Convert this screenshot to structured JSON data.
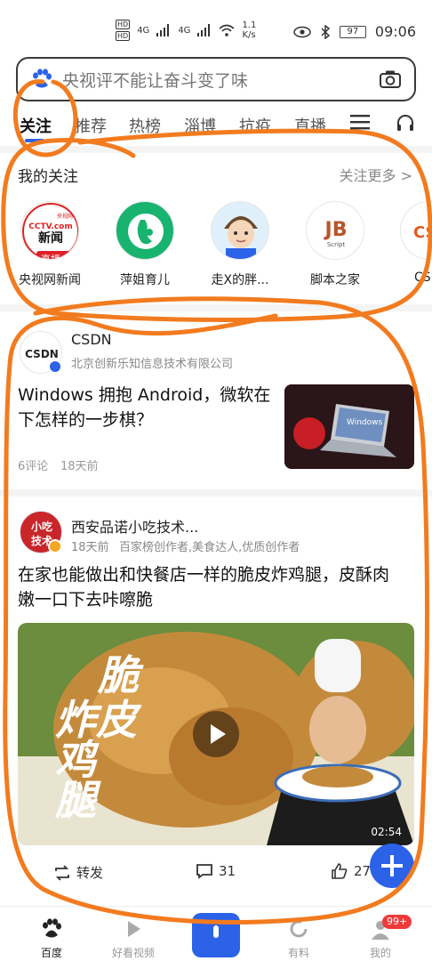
{
  "status_bar": {
    "hd_top": "HD",
    "hd_bottom": "HD",
    "net1": "4G",
    "net2": "4G",
    "speed": "1.1",
    "speed_unit": "K/s",
    "battery": "97",
    "time": "09:06"
  },
  "search": {
    "placeholder": "央视评不能让奋斗变了味"
  },
  "tabs": [
    "关注",
    "推荐",
    "热榜",
    "淄博",
    "抗疫",
    "直播"
  ],
  "active_tab": "关注",
  "follow_section": {
    "title": "我的关注",
    "more": "关注更多 >",
    "items": [
      {
        "name": "央视网新闻",
        "logo_line1": "CCTV.com",
        "logo_line2": "新闻",
        "logo_small": "央视网",
        "badge": "直播中"
      },
      {
        "name": "萍姐育儿"
      },
      {
        "name": "走X的胖..."
      },
      {
        "name": "脚本之家",
        "logo": "JB",
        "logo_sub": "Script"
      },
      {
        "name": "CS",
        "logo": "CS"
      }
    ]
  },
  "feed": [
    {
      "source_name": "CSDN",
      "source_logo": "CSDN",
      "source_meta": "北京创新乐知信息技术有限公司",
      "headline_line1": "Windows 拥抱 Android，微软在",
      "headline_line2": "下怎样的一步棋？",
      "comments": "6评论",
      "age": "18天前",
      "thumb_text": "Windows"
    },
    {
      "source_name": "西安品诺小吃技术...",
      "source_logo_line1": "小吃",
      "source_logo_line2": "技术",
      "source_meta_age": "18天前",
      "source_meta_desc": "百家榜创作者,美食达人,优质创作者",
      "headline_line1": "在家也能做出和快餐店一样的脆皮炸鸡腿，皮酥肉",
      "headline_line2": "嫩一口下去咔嚓脆",
      "video_title_1": "脆",
      "video_title_2": "炸皮",
      "video_title_3": "鸡",
      "video_title_4": "腿",
      "duration": "02:54",
      "forward_label": "转发",
      "comments_count": "31",
      "likes_count": "27"
    }
  ],
  "bottom_nav": {
    "items": [
      "百度",
      "好看视频",
      "",
      "有料",
      "我的"
    ],
    "badge": "99+"
  },
  "colors": {
    "accent": "#2b62e8",
    "annotation": "#f27b1f",
    "live_red": "#e0202a"
  }
}
